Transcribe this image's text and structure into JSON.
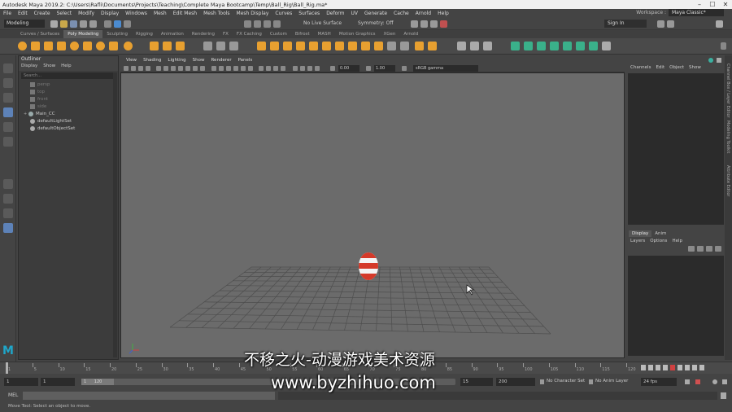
{
  "window": {
    "title": "Autodesk Maya 2019.2: C:\\Users\\Rafli\\Documents\\Projects\\Teaching\\Complete Maya Bootcamp\\Temp\\Ball_Rig\\Ball_Rig.ma*",
    "min": "–",
    "max": "☐",
    "close": "✕"
  },
  "menubar": {
    "items": [
      "File",
      "Edit",
      "Create",
      "Select",
      "Modify",
      "Display",
      "Windows",
      "Mesh",
      "Edit Mesh",
      "Mesh Tools",
      "Mesh Display",
      "Curves",
      "Surfaces",
      "Deform",
      "UV",
      "Generate",
      "Cache",
      "Arnold",
      "Help"
    ],
    "workspace_label": "Workspace :",
    "workspace_value": "Maya Classic*"
  },
  "statusline": {
    "mode": "Modeling",
    "live_surface": "No Live Surface",
    "symmetry": "Symmetry: Off",
    "sign_in": "Sign In"
  },
  "shelf": {
    "tabs": [
      "Curves / Surfaces",
      "Poly Modeling",
      "Sculpting",
      "Rigging",
      "Animation",
      "Rendering",
      "FX",
      "FX Caching",
      "Custom",
      "Bifrost",
      "MASH",
      "Motion Graphics",
      "XGen",
      "Arnold"
    ],
    "active_tab": "Poly Modeling"
  },
  "outliner": {
    "title": "Outliner",
    "menu": [
      "Display",
      "Show",
      "Help"
    ],
    "search_placeholder": "Search...",
    "items": [
      {
        "label": "persp",
        "dim": true
      },
      {
        "label": "top",
        "dim": true
      },
      {
        "label": "front",
        "dim": true
      },
      {
        "label": "side",
        "dim": true
      },
      {
        "label": "Main_CC",
        "dim": false
      },
      {
        "label": "defaultLightSet",
        "dim": false
      },
      {
        "label": "defaultObjectSet",
        "dim": false
      }
    ]
  },
  "viewport": {
    "menu": [
      "View",
      "Shading",
      "Lighting",
      "Show",
      "Renderer",
      "Panels"
    ],
    "field_a": "0.00",
    "field_b": "1.00",
    "colorspace": "sRGB gamma"
  },
  "channelbox": {
    "menu": [
      "Channels",
      "Edit",
      "Object",
      "Show"
    ],
    "side_tabs": [
      "Channel Box / Layer Editor",
      "Modeling Toolkit",
      "Attribute Editor"
    ]
  },
  "layers": {
    "tabs": [
      "Display",
      "Anim"
    ],
    "active_tab": "Display",
    "menu": [
      "Layers",
      "Options",
      "Help"
    ]
  },
  "timeslider": {
    "ticks": [
      "1",
      "5",
      "10",
      "15",
      "20",
      "25",
      "30",
      "35",
      "40",
      "45",
      "50",
      "55",
      "60",
      "65",
      "70",
      "75",
      "80",
      "85",
      "90",
      "95",
      "100",
      "105",
      "110",
      "115",
      "120"
    ],
    "current": "1"
  },
  "range": {
    "start": "1",
    "playback_start": "1",
    "slider_label": "1",
    "slider_end": "120",
    "playback_end": "120",
    "end_a": "15",
    "end_b": "200",
    "character_set": "No Character Set",
    "anim_layer": "No Anim Layer",
    "fps": "24 fps"
  },
  "cmdline": {
    "mel_label": "MEL",
    "help_text": "Move Tool: Select an object to move."
  },
  "watermark": {
    "line1": "不移之火-动漫游戏美术资源",
    "line2": "www.byzhihuo.com"
  },
  "colors": {
    "ball_red": "#d43a2a",
    "ball_white": "#f4f4f4",
    "viewport_bg": "#6b6b6b",
    "grid_line": "#4e4e4e",
    "maya_blue": "#1fa6c9"
  }
}
